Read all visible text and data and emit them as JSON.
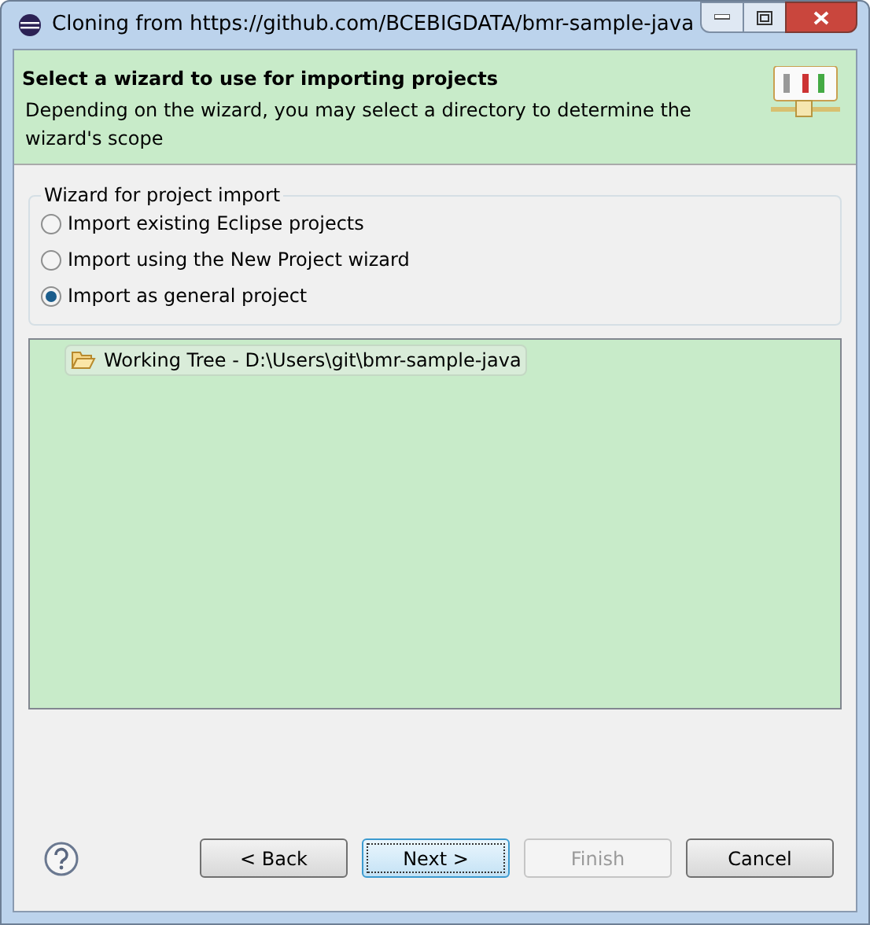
{
  "window": {
    "title": "Cloning from https://github.com/BCEBIGDATA/bmr-sample-java"
  },
  "header": {
    "title": "Select a wizard to use for importing projects",
    "description": "Depending on the wizard, you may select a directory to determine the wizard's scope"
  },
  "wizard_group": {
    "label": "Wizard for project import",
    "options": [
      {
        "label": "Import existing Eclipse projects",
        "selected": false
      },
      {
        "label": "Import using the New Project wizard",
        "selected": false
      },
      {
        "label": "Import as general project",
        "selected": true
      }
    ]
  },
  "tree": {
    "items": [
      {
        "label": "Working Tree - D:\\Users\\git\\bmr-sample-java",
        "selected": true
      }
    ]
  },
  "buttons": [
    {
      "label": "< Back",
      "disabled": false,
      "default": false
    },
    {
      "label": "Next >",
      "disabled": false,
      "default": true
    },
    {
      "label": "Finish",
      "disabled": true,
      "default": false
    },
    {
      "label": "Cancel",
      "disabled": false,
      "default": false
    }
  ]
}
